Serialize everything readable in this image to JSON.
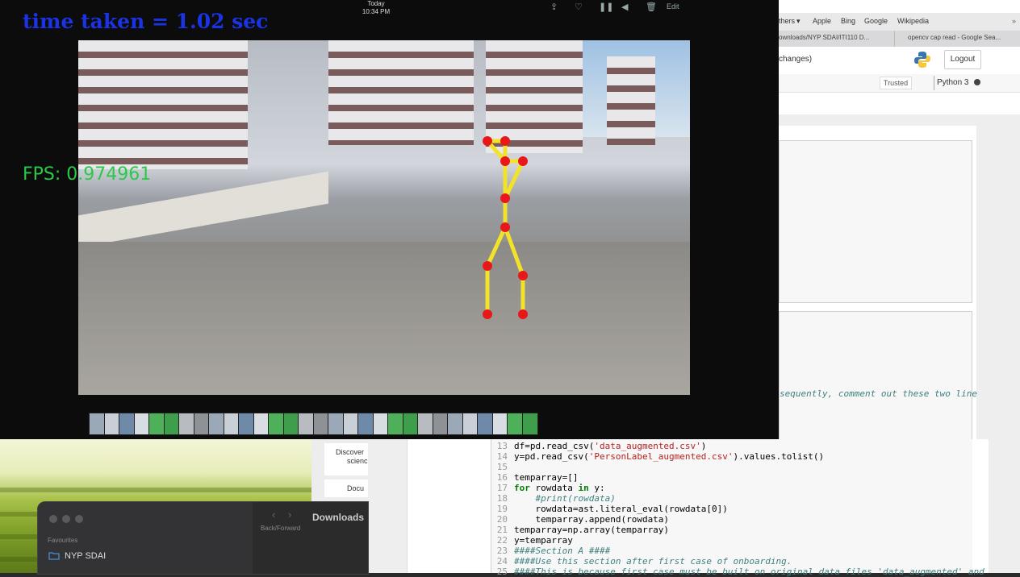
{
  "video_overlay": {
    "time_taken": "time taken = 1.02 sec",
    "fps": "FPS: 0.974961"
  },
  "player": {
    "date_label": "Today",
    "time_label": "10:34 PM",
    "edit_label": "Edit",
    "controls": [
      "share-icon",
      "heart-icon",
      "pause-icon",
      "mute-icon",
      "trash-icon"
    ]
  },
  "browser": {
    "bookmarks": [
      "thers",
      "Apple",
      "Bing",
      "Google",
      "Wikipedia"
    ],
    "tabs": [
      "ownloads/NYP SDAI/ITI110 D...",
      "opencv cap read - Google Sea..."
    ],
    "notebook_status": "changes)",
    "logout_label": "Logout",
    "trusted_label": "Trusted",
    "kernel_label": "Python 3"
  },
  "notebook": {
    "partial_line": "sequently, comment out these two line",
    "code_lines": [
      {
        "num": "13",
        "html": "df=pd.read_csv(<span class='str'>'data_augmented.csv'</span>)"
      },
      {
        "num": "14",
        "html": "y=pd.read_csv(<span class='str'>'PersonLabel_augmented.csv'</span>).values.tolist()"
      },
      {
        "num": "15",
        "html": ""
      },
      {
        "num": "16",
        "html": "temparray=[]"
      },
      {
        "num": "17",
        "html": "<span class='kw'>for</span> rowdata <span class='kw'>in</span> y:"
      },
      {
        "num": "18",
        "html": "    <span class='cm'>#print(rowdata)</span>"
      },
      {
        "num": "19",
        "html": "    rowdata=ast.literal_eval(rowdata[0])"
      },
      {
        "num": "20",
        "html": "    temparray.append(rowdata)"
      },
      {
        "num": "21",
        "html": "temparray=np.array(temparray)"
      },
      {
        "num": "22",
        "html": "y=temparray"
      },
      {
        "num": "23",
        "html": "<span class='cm'>####Section A ####</span>"
      },
      {
        "num": "24",
        "html": "<span class='cm'>####Use this section after first case of onboarding.</span>"
      },
      {
        "num": "25",
        "html": "<span class='cm'>####This is because first case must be built on original data files 'data_augmented' and</span>"
      }
    ]
  },
  "side_window": {
    "line1": "Discover",
    "line2": "scienc",
    "button": "Docu"
  },
  "finder": {
    "nav_label": "Back/Forward",
    "title": "Downloads",
    "section": "Favourites",
    "item1": "NYP SDAI"
  }
}
